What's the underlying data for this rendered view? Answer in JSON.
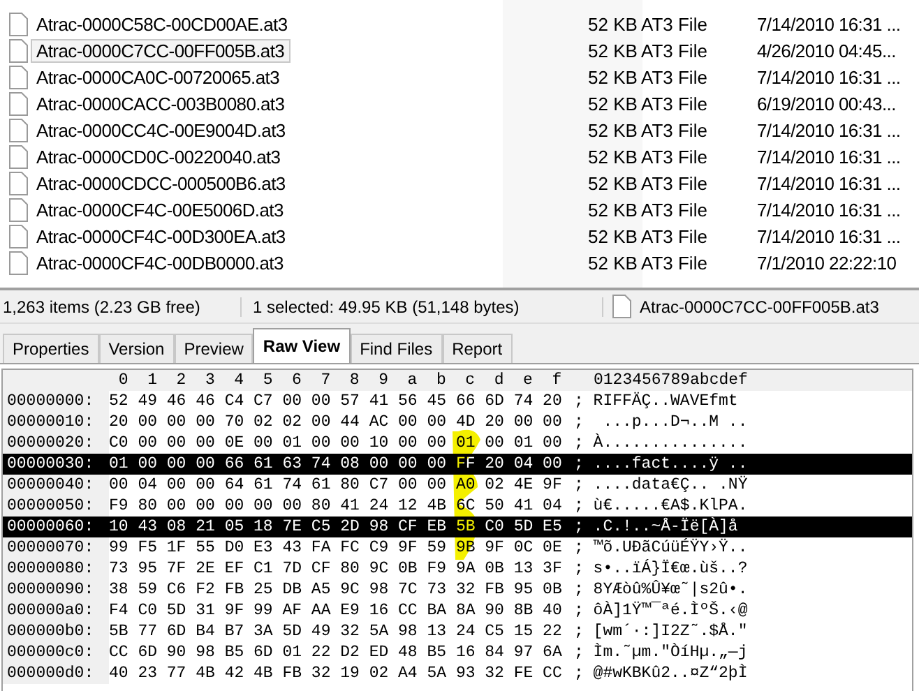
{
  "file_list": {
    "rows": [
      {
        "name": "Atrac-0000C58C-00CD00AE.at3",
        "size": "52 KB",
        "type": "AT3 File",
        "date": "7/14/2010 16:31 ...",
        "selected": false
      },
      {
        "name": "Atrac-0000C7CC-00FF005B.at3",
        "size": "52 KB",
        "type": "AT3 File",
        "date": "4/26/2010 04:45...",
        "selected": true
      },
      {
        "name": "Atrac-0000CA0C-00720065.at3",
        "size": "52 KB",
        "type": "AT3 File",
        "date": "7/14/2010 16:31 ...",
        "selected": false
      },
      {
        "name": "Atrac-0000CACC-003B0080.at3",
        "size": "52 KB",
        "type": "AT3 File",
        "date": "6/19/2010 00:43...",
        "selected": false
      },
      {
        "name": "Atrac-0000CC4C-00E9004D.at3",
        "size": "52 KB",
        "type": "AT3 File",
        "date": "7/14/2010 16:31 ...",
        "selected": false
      },
      {
        "name": "Atrac-0000CD0C-00220040.at3",
        "size": "52 KB",
        "type": "AT3 File",
        "date": "7/14/2010 16:31 ...",
        "selected": false
      },
      {
        "name": "Atrac-0000CDCC-000500B6.at3",
        "size": "52 KB",
        "type": "AT3 File",
        "date": "7/14/2010 16:31 ...",
        "selected": false
      },
      {
        "name": "Atrac-0000CF4C-00E5006D.at3",
        "size": "52 KB",
        "type": "AT3 File",
        "date": "7/14/2010 16:31 ...",
        "selected": false
      },
      {
        "name": "Atrac-0000CF4C-00D300EA.at3",
        "size": "52 KB",
        "type": "AT3 File",
        "date": "7/14/2010 16:31 ...",
        "selected": false
      },
      {
        "name": "Atrac-0000CF4C-00DB0000.at3",
        "size": "52 KB",
        "type": "AT3 File",
        "date": "7/1/2010 22:22:10",
        "selected": false
      }
    ]
  },
  "status_bar": {
    "items": "1,263 items (2.23 GB free)",
    "selection": "1 selected: 49.95 KB (51,148 bytes)",
    "file": "Atrac-0000C7CC-00FF005B.at3"
  },
  "tabs": [
    {
      "label": "Properties",
      "selected": false
    },
    {
      "label": "Version",
      "selected": false
    },
    {
      "label": "Preview",
      "selected": false
    },
    {
      "label": "Raw View",
      "selected": true
    },
    {
      "label": "Find Files",
      "selected": false
    },
    {
      "label": "Report",
      "selected": false
    }
  ],
  "hex_view": {
    "columns": [
      "0",
      "1",
      "2",
      "3",
      "4",
      "5",
      "6",
      "7",
      "8",
      "9",
      "a",
      "b",
      "c",
      "d",
      "e",
      "f"
    ],
    "ascii_header": "0123456789abcdef",
    "rows": [
      {
        "offset": "00000000:",
        "bytes": "52 49 46 46 C4 C7 00 00 57 41 56 45 66 6D 74 20",
        "ascii": "; RIFFÄÇ..WAVEfmt",
        "selected": false
      },
      {
        "offset": "00000010:",
        "bytes": "20 00 00 00 70 02 02 00 44 AC 00 00 4D 20 00 00",
        "ascii": ";  ...p...D¬..M ..",
        "selected": false
      },
      {
        "offset": "00000020:",
        "bytes": "C0 00 00 00 0E 00 01 00 00 10 00 00 01 00 01 00",
        "ascii": "; À...............",
        "selected": false
      },
      {
        "offset": "00000030:",
        "bytes": "01 00 00 00 66 61 63 74 08 00 00 00 FF 20 04 00",
        "ascii": "; ....fact....ÿ ..",
        "selected": true
      },
      {
        "offset": "00000040:",
        "bytes": "00 04 00 00 64 61 74 61 80 C7 00 00 A0 02 4E 9F",
        "ascii": "; ....data€Ç.. .NŸ",
        "selected": false
      },
      {
        "offset": "00000050:",
        "bytes": "F9 80 00 00 00 00 00 80 41 24 12 4B 6C 50 41 04",
        "ascii": "; ù€.....€A$.KlPA.",
        "selected": false
      },
      {
        "offset": "00000060:",
        "bytes": "10 43 08 21 05 18 7E C5 2D 98 CF EB 5B C0 5D E5",
        "ascii": "; .C.!..~Å-Ïë[À]å",
        "selected": true
      },
      {
        "offset": "00000070:",
        "bytes": "99 F5 1F 55 D0 E3 43 FA FC C9 9F 59 9B 9F 0C 0E",
        "ascii": "; ™õ.UÐãCúüÉŸY›Ÿ..",
        "selected": false
      },
      {
        "offset": "00000080:",
        "bytes": "73 95 7F 2E EF C1 7D CF 80 9C 0B F9 9A 0B 13 3F",
        "ascii": "; s•..ïÁ}Ï€œ.ùš..?",
        "selected": false
      },
      {
        "offset": "00000090:",
        "bytes": "38 59 C6 F2 FB 25 DB A5 9C 98 7C 73 32 FB 95 0B",
        "ascii": "; 8YÆòû%Û¥œ˜|s2û•.",
        "selected": false
      },
      {
        "offset": "000000a0:",
        "bytes": "F4 C0 5D 31 9F 99 AF AA E9 16 CC BA 8A 90 8B 40",
        "ascii": "; ôÀ]1Ÿ™¯ªé.ÌºŠ.‹@",
        "selected": false
      },
      {
        "offset": "000000b0:",
        "bytes": "5B 77 6D B4 B7 3A 5D 49 32 5A 98 13 24 C5 15 22",
        "ascii": "; [wm´·:]I2Z˜.$Å.\"",
        "selected": false
      },
      {
        "offset": "000000c0:",
        "bytes": "CC 6D 90 98 B5 6D 01 22 D2 ED 48 B5 16 84 97 6A",
        "ascii": "; Ìm.˜µm.\"ÒíHµ.„—j",
        "selected": false
      },
      {
        "offset": "000000d0:",
        "bytes": "40 23 77 4B 42 4B FB 32 19 02 A4 5A 93 32 FE CC",
        "ascii": "; @#wKBKû2..¤Z“2þÌ",
        "selected": false
      }
    ]
  }
}
